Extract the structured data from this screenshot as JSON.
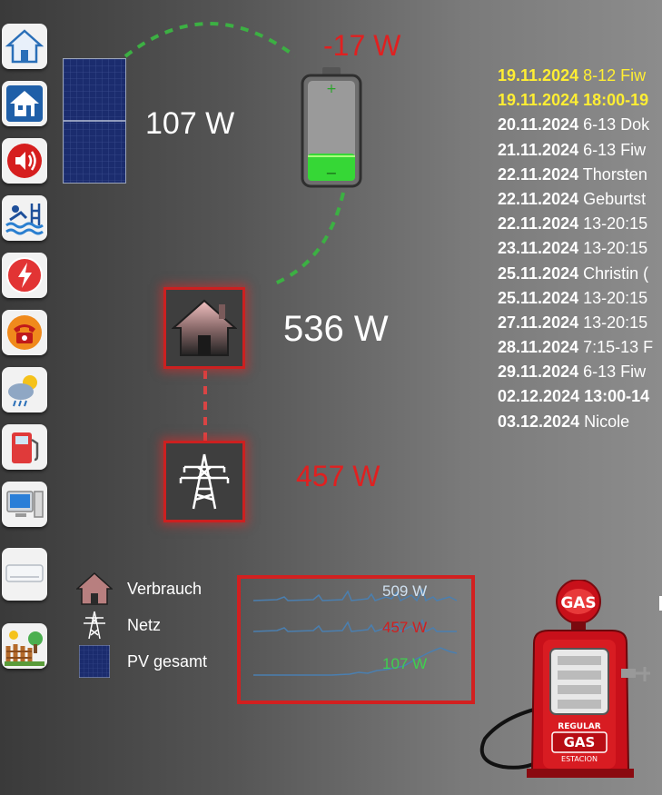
{
  "flow": {
    "pv_power": "107 W",
    "battery_power": "-17 W",
    "house_power": "536 W",
    "grid_power": "457 W"
  },
  "sidebar": {
    "items": [
      {
        "name": "home-icon"
      },
      {
        "name": "house-icon"
      },
      {
        "name": "speaker-icon"
      },
      {
        "name": "pool-icon"
      },
      {
        "name": "power-icon"
      },
      {
        "name": "phone-icon"
      },
      {
        "name": "weather-icon"
      },
      {
        "name": "fuel-icon"
      },
      {
        "name": "computer-icon"
      },
      {
        "name": "air-conditioner-icon"
      },
      {
        "name": "garden-icon"
      }
    ]
  },
  "events": [
    {
      "date": "19.11.2024",
      "text": "8-12 Fiw",
      "highlight": true,
      "bold": false
    },
    {
      "date": "19.11.2024",
      "text": "18:00-19",
      "highlight": true,
      "bold": true
    },
    {
      "date": "20.11.2024",
      "text": "6-13 Dok",
      "highlight": false,
      "bold": false
    },
    {
      "date": "21.11.2024",
      "text": "6-13 Fiw",
      "highlight": false,
      "bold": false
    },
    {
      "date": "22.11.2024",
      "text": "Thorsten",
      "highlight": false,
      "bold": false
    },
    {
      "date": "22.11.2024",
      "text": "Geburtst",
      "highlight": false,
      "bold": false
    },
    {
      "date": "22.11.2024",
      "text": "13-20:15",
      "highlight": false,
      "bold": false
    },
    {
      "date": "23.11.2024",
      "text": "13-20:15",
      "highlight": false,
      "bold": false
    },
    {
      "date": "25.11.2024",
      "text": "Christin (",
      "highlight": false,
      "bold": false
    },
    {
      "date": "25.11.2024",
      "text": "13-20:15",
      "highlight": false,
      "bold": false
    },
    {
      "date": "27.11.2024",
      "text": "13-20:15",
      "highlight": false,
      "bold": false
    },
    {
      "date": "28.11.2024",
      "text": "7:15-13 F",
      "highlight": false,
      "bold": false
    },
    {
      "date": "29.11.2024",
      "text": "6-13 Fiw",
      "highlight": false,
      "bold": false
    },
    {
      "date": "02.12.2024",
      "text": "13:00-14",
      "highlight": false,
      "bold": true
    },
    {
      "date": "03.12.2024",
      "text": "Nicole",
      "highlight": false,
      "bold": false
    }
  ],
  "legend": {
    "consumption_label": "Verbrauch",
    "grid_label": "Netz",
    "pv_label": "PV gesamt"
  },
  "sparks": {
    "consumption_value": "509 W",
    "grid_value": "457 W",
    "pv_value": "107 W"
  },
  "gas_pump": {
    "top_sign": "GAS",
    "label_regular": "REGULAR",
    "label_gas": "GAS",
    "label_station": "ESTACION"
  },
  "colors": {
    "accent_red": "#e02020",
    "flow_green": "#3cb043",
    "highlight_yellow": "#ffee33",
    "spark_blue": "#4a7fb0",
    "pv_green": "#3fd04f",
    "sparkbox_border": "#d22020"
  }
}
